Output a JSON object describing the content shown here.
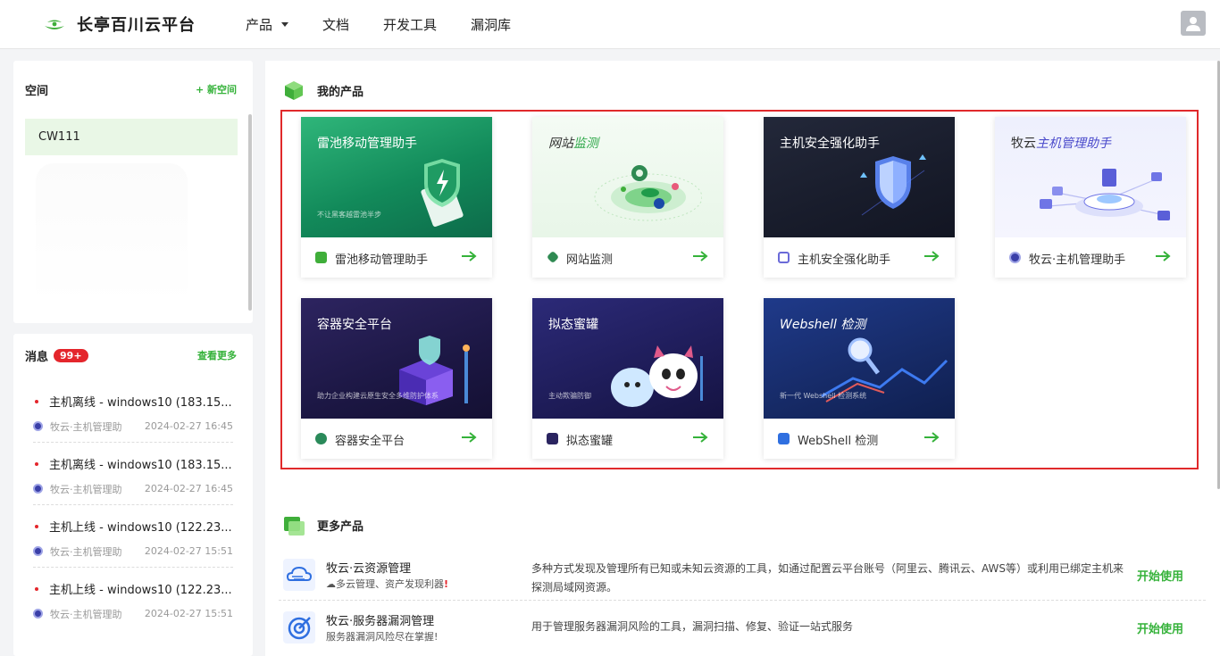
{
  "header": {
    "logo_text": "长亭百川云平台",
    "nav": [
      "产品",
      "文档",
      "开发工具",
      "漏洞库"
    ]
  },
  "space": {
    "title": "空间",
    "new_label": "+ 新空间",
    "items": [
      "CW111"
    ]
  },
  "messages": {
    "title": "消息",
    "badge": "99+",
    "more_label": "查看更多",
    "items": [
      {
        "text": "主机离线 - windows10 (183.15...",
        "source": "牧云·主机管理助",
        "time": "2024-02-27 16:45"
      },
      {
        "text": "主机离线 - windows10 (183.15...",
        "source": "牧云·主机管理助",
        "time": "2024-02-27 16:45"
      },
      {
        "text": "主机上线 - windows10 (122.23...",
        "source": "牧云·主机管理助",
        "time": "2024-02-27 15:51"
      },
      {
        "text": "主机上线 - windows10 (122.23...",
        "source": "牧云·主机管理助",
        "time": "2024-02-27 15:51"
      }
    ]
  },
  "my_products": {
    "title": "我的产品",
    "items": [
      {
        "banner_title": "雷池移动管理助手",
        "banner_sub": "不让黑客越雷池半步",
        "label": "雷池移动管理助手"
      },
      {
        "banner_title_a": "网站",
        "banner_title_b": "监测",
        "label": "网站监测"
      },
      {
        "banner_title": "主机安全强化助手",
        "label": "主机安全强化助手"
      },
      {
        "banner_title_a": "牧云",
        "banner_title_b": "主机管理助手",
        "label": "牧云·主机管理助手"
      },
      {
        "banner_title": "容器安全平台",
        "banner_sub": "助力企业构建云原生安全多维防护体系",
        "label": "容器安全平台"
      },
      {
        "banner_title": "拟态蜜罐",
        "banner_sub": "主动欺骗防御",
        "label": "拟态蜜罐"
      },
      {
        "banner_title": "Webshell 检测",
        "banner_sub": "新一代 Webshell 检测系统",
        "label": "WebShell 检测"
      }
    ]
  },
  "more_products": {
    "title": "更多产品",
    "items": [
      {
        "name": "牧云·云资源管理",
        "sub": "☁多云管理、资产发现利器",
        "sub_mark": "!",
        "desc": "多种方式发现及管理所有已知或未知云资源的工具，如通过配置云平台账号（阿里云、腾讯云、AWS等）或利用已绑定主机来探测局域网资源。",
        "action": "开始使用"
      },
      {
        "name": "牧云·服务器漏洞管理",
        "sub": "服务器漏洞风险尽在掌握!",
        "desc": "用于管理服务器漏洞风险的工具，漏洞扫描、修复、验证一站式服务",
        "action": "开始使用"
      }
    ]
  },
  "colors": {
    "accent_green": "#35b23a",
    "badge_red": "#e4262c",
    "frame_red": "#e0292b"
  }
}
